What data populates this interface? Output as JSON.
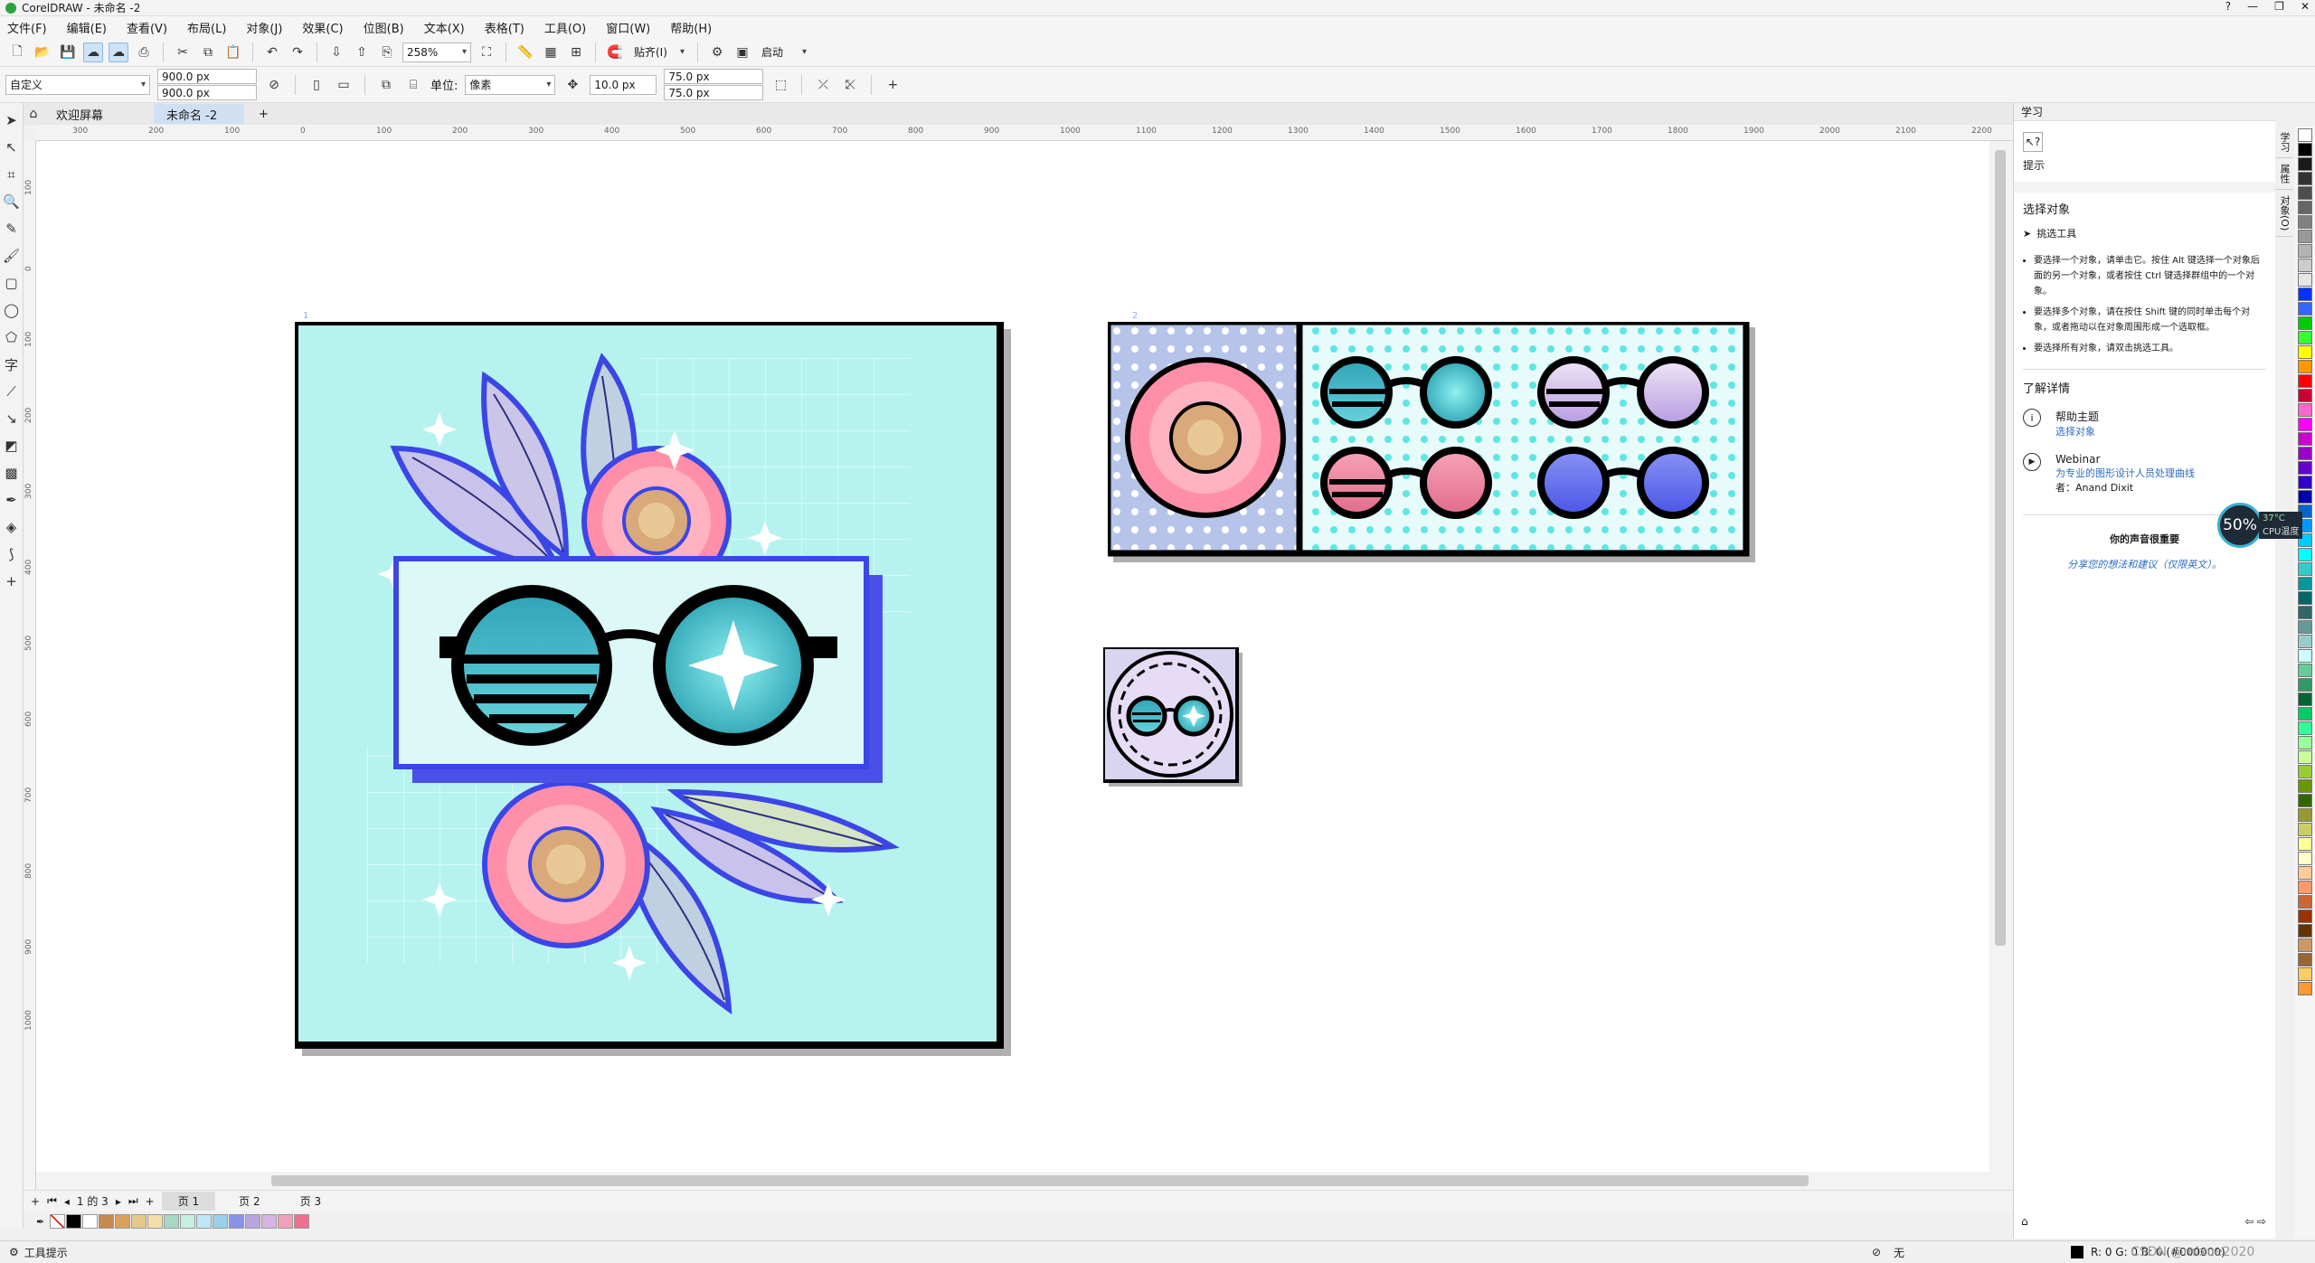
{
  "window": {
    "title": "CorelDRAW - 未命名 -2",
    "controls": [
      "?",
      "—",
      "❐",
      "✕"
    ]
  },
  "menu": [
    "文件(F)",
    "编辑(E)",
    "查看(V)",
    "布局(L)",
    "对象(J)",
    "效果(C)",
    "位图(B)",
    "文本(X)",
    "表格(T)",
    "工具(O)",
    "窗口(W)",
    "帮助(H)"
  ],
  "toolbar1": {
    "zoom": "258%",
    "snap_label": "贴齐(I)",
    "launch_label": "启动"
  },
  "toolbar2": {
    "page_size": "自定义",
    "width": "900.0 px",
    "height": "900.0 px",
    "unit_label": "单位:",
    "unit": "像素",
    "nudge": "10.0 px",
    "dup_x": "75.0 px",
    "dup_y": "75.0 px"
  },
  "tabs": {
    "welcome": "欢迎屏幕",
    "document": "未命名 -2",
    "add": "+"
  },
  "ruler_h": [
    "300",
    "200",
    "100",
    "0",
    "100",
    "200",
    "300",
    "400",
    "500",
    "600",
    "700",
    "800",
    "900",
    "1000",
    "1100",
    "1200",
    "1300",
    "1400",
    "1500",
    "1600",
    "1700",
    "1800",
    "1900",
    "2000",
    "2100",
    "2200"
  ],
  "ruler_v": [
    "100",
    "0",
    "100",
    "200",
    "300",
    "400",
    "500",
    "600",
    "700",
    "800",
    "900",
    "1000"
  ],
  "pages": {
    "p1": "1",
    "p2": "2",
    "p3": "3"
  },
  "page_nav": {
    "counter": "1 的 3",
    "tabs": [
      "页 1",
      "页 2",
      "页 3"
    ]
  },
  "doc_palette": [
    "#000000",
    "#ffffff",
    "#c68a4e",
    "#d8a25c",
    "#e4c98e",
    "#f3e0a8",
    "#a7d8c4",
    "#c6eee3",
    "#bfe7f5",
    "#9ad0ea",
    "#8a92e8",
    "#b8a4e0",
    "#d7b4e4",
    "#f0a0b8",
    "#ee6f8f"
  ],
  "docker": {
    "title": "学习",
    "hint_label": "提示",
    "select_heading": "选择对象",
    "tool_name": "挑选工具",
    "tip1": "要选择一个对象，请单击它。按住 Alt 键选择一个对象后面的另一个对象，或者按住 Ctrl 键选择群组中的一个对象。",
    "tip2": "要选择多个对象，请在按住 Shift 键的同时单击每个对象，或者拖动以在对象周围形成一个选取框。",
    "tip3": "要选择所有对象，请双击挑选工具。",
    "more_heading": "了解详情",
    "help_topic": "帮助主题",
    "help_link": "选择对象",
    "webinar": "Webinar",
    "webinar_desc": "为专业的图形设计人员处理曲线",
    "webinar_author": "者：Anand Dixit",
    "voice_heading": "你的声音很重要",
    "voice_link": "分享您的想法和建议（仅限英文）。"
  },
  "docker_tabs": [
    "学习",
    "属性",
    "对象(O)"
  ],
  "palette": [
    "#ffffff",
    "#000000",
    "#1a1a1a",
    "#333333",
    "#4d4d4d",
    "#666666",
    "#808080",
    "#999999",
    "#b3b3b3",
    "#cccccc",
    "#e6e6e6",
    "#0033ff",
    "#3366ff",
    "#00cc00",
    "#33ff33",
    "#ffff00",
    "#ff9900",
    "#ff0000",
    "#cc0033",
    "#ff66cc",
    "#ff00ff",
    "#cc00cc",
    "#9900cc",
    "#6600cc",
    "#3300cc",
    "#0000aa",
    "#0066cc",
    "#0099ff",
    "#00ccff",
    "#00ffff",
    "#33cccc",
    "#009999",
    "#006666",
    "#336666",
    "#669999",
    "#99cccc",
    "#ccffff",
    "#66cc99",
    "#339966",
    "#006633",
    "#00cc66",
    "#33ff99",
    "#99ff99",
    "#ccff99",
    "#99cc33",
    "#669900",
    "#336600",
    "#999933",
    "#cccc66",
    "#ffff99",
    "#ffffcc",
    "#ffcc99",
    "#ff9966",
    "#cc6633",
    "#993300",
    "#663300",
    "#cc9966",
    "#996633",
    "#ffcc66",
    "#ff9933"
  ],
  "cpu": {
    "percent": "50%",
    "temp": "37°C",
    "label": "CPU温度"
  },
  "status": {
    "hint": "工具提示",
    "fill_none": "无",
    "color_readout": "R: 0 G: 0 B: 0 (#000000)",
    "watermark": "CSDN @mixue2020"
  }
}
